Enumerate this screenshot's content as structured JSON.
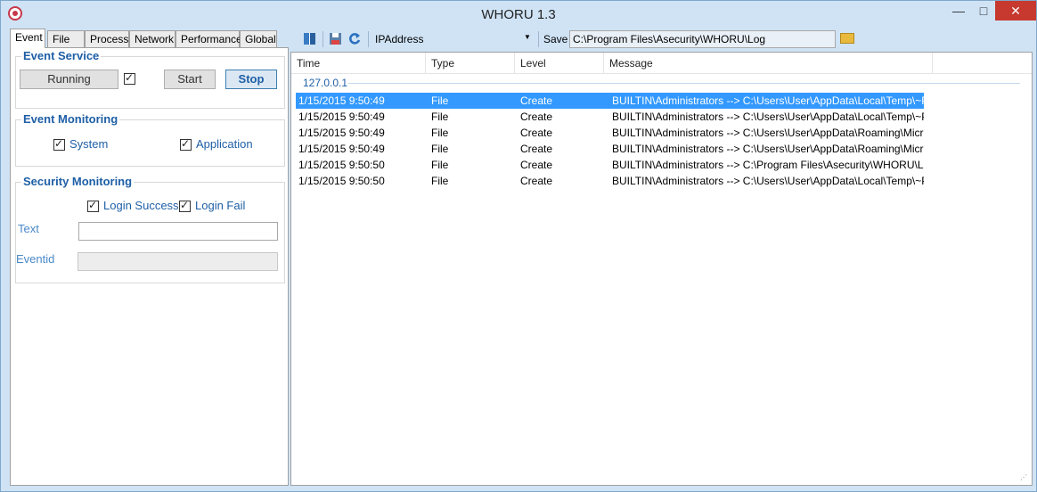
{
  "window": {
    "title": "WHORU 1.3",
    "minimize_glyph": "—",
    "maximize_glyph": "□",
    "close_glyph": "✕"
  },
  "tabs": [
    {
      "label": "Event",
      "active": true
    },
    {
      "label": "File",
      "active": false
    },
    {
      "label": "Process",
      "active": false
    },
    {
      "label": "Network",
      "active": false
    },
    {
      "label": "Performance",
      "active": false
    },
    {
      "label": "Global",
      "active": false
    }
  ],
  "event_service": {
    "title": "Event Service",
    "status": "Running",
    "status_checked": true,
    "start_label": "Start",
    "stop_label": "Stop"
  },
  "event_monitoring": {
    "title": "Event Monitoring",
    "system_label": "System",
    "system_checked": true,
    "application_label": "Application",
    "application_checked": true
  },
  "security_monitoring": {
    "title": "Security Monitoring",
    "login_success_label": "Login Success",
    "login_success_checked": true,
    "login_fail_label": "Login Fail",
    "login_fail_checked": true,
    "text_label": "Text",
    "text_value": "",
    "eventid_label": "Eventid",
    "eventid_value": ""
  },
  "toolbar": {
    "icons": [
      "book-icon",
      "save-icon",
      "refresh-icon"
    ],
    "ip_label": "IPAddress",
    "dropdown_arrow": "▼",
    "save_label": "Save",
    "save_path": "C:\\Program Files\\Asecurity\\WHORU\\Log",
    "folder_icon": "folder-icon"
  },
  "log": {
    "columns": [
      "Time",
      "Type",
      "Level",
      "Message"
    ],
    "group": "127.0.0.1",
    "rows": [
      {
        "time": "1/15/2015 9:50:49",
        "type": "File",
        "level": "Create",
        "message": "BUILTIN\\Administrators --> C:\\Users\\User\\AppData\\Local\\Temp\\~PI...",
        "selected": true
      },
      {
        "time": "1/15/2015 9:50:49",
        "type": "File",
        "level": "Create",
        "message": "BUILTIN\\Administrators --> C:\\Users\\User\\AppData\\Local\\Temp\\~PI...",
        "selected": false
      },
      {
        "time": "1/15/2015 9:50:49",
        "type": "File",
        "level": "Create",
        "message": "BUILTIN\\Administrators --> C:\\Users\\User\\AppData\\Roaming\\Microso...",
        "selected": false
      },
      {
        "time": "1/15/2015 9:50:49",
        "type": "File",
        "level": "Create",
        "message": "BUILTIN\\Administrators --> C:\\Users\\User\\AppData\\Roaming\\Microso...",
        "selected": false
      },
      {
        "time": "1/15/2015 9:50:50",
        "type": "File",
        "level": "Create",
        "message": "BUILTIN\\Administrators --> C:\\Program Files\\Asecurity\\WHORU\\Log\\W...",
        "selected": false
      },
      {
        "time": "1/15/2015 9:50:50",
        "type": "File",
        "level": "Create",
        "message": "BUILTIN\\Administrators --> C:\\Users\\User\\AppData\\Local\\Temp\\~PI...",
        "selected": false
      }
    ]
  },
  "colors": {
    "accent": "#1e5fa6",
    "selection": "#3399ff",
    "chrome": "#cfe3f5",
    "close": "#c7392e"
  }
}
